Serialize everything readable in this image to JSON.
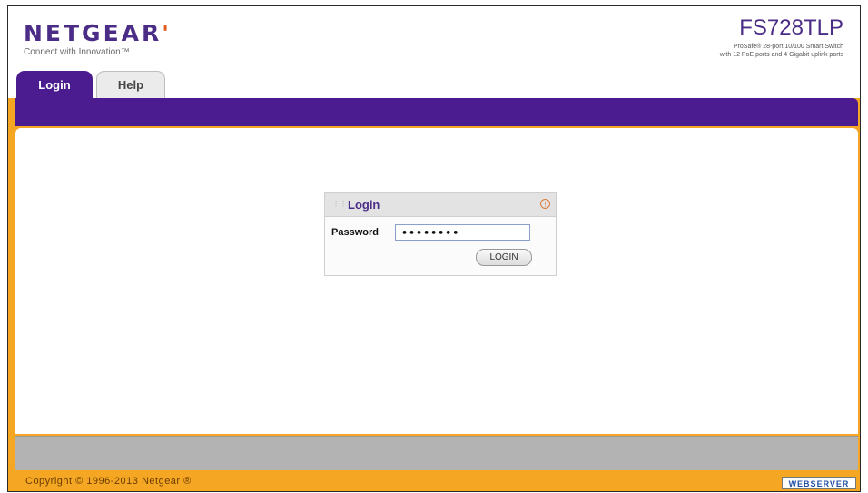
{
  "header": {
    "logo_text": "NETGEAR",
    "logo_mark": "'",
    "tagline": "Connect with Innovation™",
    "model": "FS728TLP",
    "description": "ProSafe® 28-port 10/100 Smart Switch\nwith 12 PoE ports and 4 Gigabit uplink ports"
  },
  "tabs": [
    {
      "label": "Login",
      "active": true
    },
    {
      "label": "Help",
      "active": false
    }
  ],
  "login_panel": {
    "title": "Login",
    "password_label": "Password",
    "password_value": "••••••••",
    "login_button": "LOGIN"
  },
  "footer": {
    "copyright": "Copyright © 1996-2013 Netgear ®",
    "badge": "WEBSERVER"
  },
  "colors": {
    "brand_purple": "#4b1c8f",
    "frame_orange": "#f5a623",
    "footer_gray": "#b3b3b3"
  }
}
